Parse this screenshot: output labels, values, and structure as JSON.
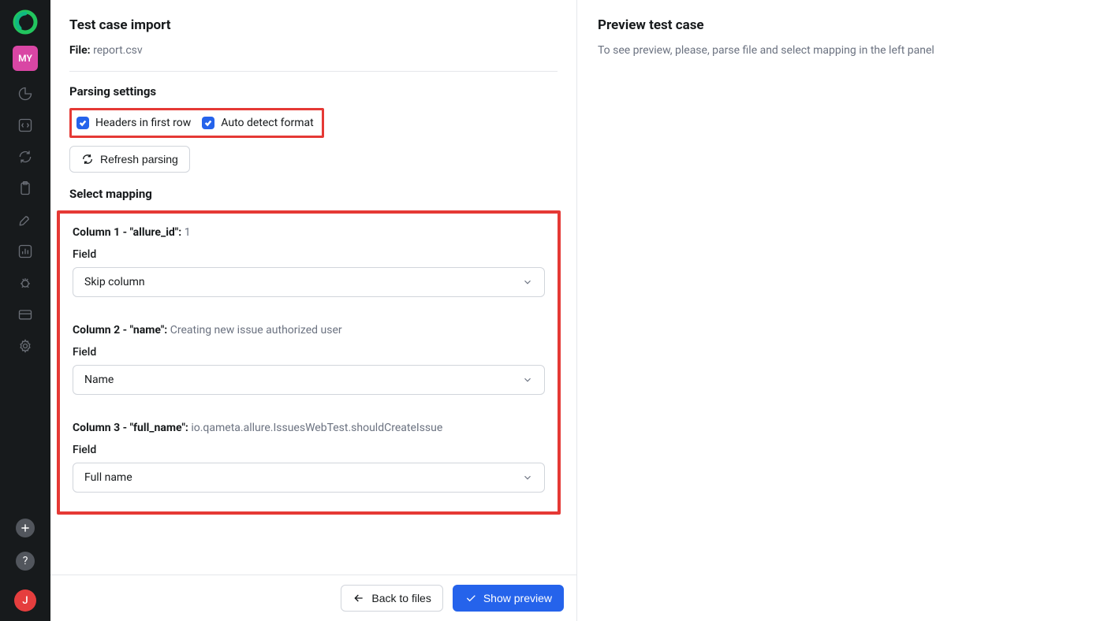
{
  "sidebar": {
    "workspace_badge": "MY",
    "user_initial": "J"
  },
  "import": {
    "title": "Test case import",
    "file_label": "File:",
    "file_name": "report.csv",
    "parsing_heading": "Parsing settings",
    "headers_checkbox_label": "Headers in first row",
    "autodetect_checkbox_label": "Auto detect format",
    "refresh_button": "Refresh parsing",
    "mapping_heading": "Select mapping",
    "field_label": "Field",
    "columns": [
      {
        "title": "Column 1 - \"allure_id\":",
        "sample": "1",
        "selected": "Skip column"
      },
      {
        "title": "Column 2 - \"name\":",
        "sample": "Creating new issue authorized user",
        "selected": "Name"
      },
      {
        "title": "Column 3 - \"full_name\":",
        "sample": "io.qameta.allure.IssuesWebTest.shouldCreateIssue",
        "selected": "Full name"
      }
    ]
  },
  "footer": {
    "back": "Back to files",
    "show_preview": "Show preview"
  },
  "preview": {
    "title": "Preview test case",
    "empty_text": "To see preview, please, parse file and select mapping in the left panel"
  }
}
